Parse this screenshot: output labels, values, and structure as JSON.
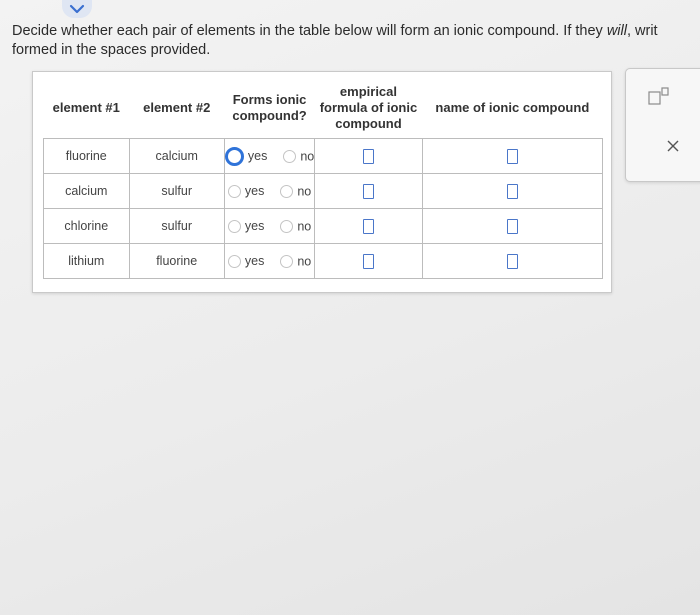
{
  "prompt": {
    "line1_start": "Decide whether each pair of elements in the table below will form an ionic compound. If they ",
    "line1_emph": "will",
    "line1_end": ", writ",
    "line2": "formed in the spaces provided."
  },
  "table": {
    "headers": {
      "element1": "element #1",
      "element2": "element #2",
      "forms_ionic": "Forms ionic compound?",
      "formula": "empirical formula of ionic compound",
      "name": "name of ionic compound"
    },
    "options": {
      "yes": "yes",
      "no": "no"
    },
    "rows": [
      {
        "element1": "fluorine",
        "element2": "calcium",
        "selected": "yes"
      },
      {
        "element1": "calcium",
        "element2": "sulfur",
        "selected": ""
      },
      {
        "element1": "chlorine",
        "element2": "sulfur",
        "selected": ""
      },
      {
        "element1": "lithium",
        "element2": "fluorine",
        "selected": ""
      }
    ]
  },
  "icons": {
    "top_tab": "chevron-down-icon",
    "superscript_tool": "superscript-box-icon",
    "close": "close-icon"
  },
  "colors": {
    "accent": "#2f73d9",
    "input_box": "#4a76c9"
  }
}
